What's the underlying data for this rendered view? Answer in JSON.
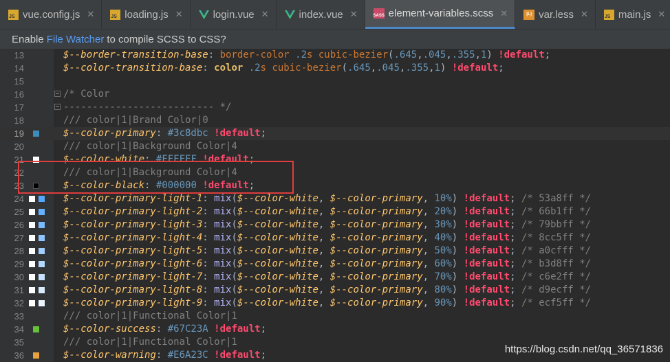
{
  "tabs": [
    {
      "label": "vue.config.js",
      "icon": "js",
      "active": false
    },
    {
      "label": "loading.js",
      "icon": "js",
      "active": false
    },
    {
      "label": "login.vue",
      "icon": "vue",
      "active": false
    },
    {
      "label": "index.vue",
      "icon": "vue",
      "active": false
    },
    {
      "label": "element-variables.scss",
      "icon": "sass",
      "active": true
    },
    {
      "label": "var.less",
      "icon": "less",
      "active": false
    },
    {
      "label": "main.js",
      "icon": "js",
      "active": false
    }
  ],
  "notice": {
    "prefix": "Enable",
    "link": "File Watcher",
    "suffix": "to compile SCSS to CSS?"
  },
  "editor": {
    "current_line": 19,
    "lines": [
      {
        "n": "13",
        "swatches": [],
        "tokens": [
          [
            "v",
            "$--border-transition-base"
          ],
          [
            "w",
            ": "
          ],
          [
            "p",
            "border-color "
          ],
          [
            "n",
            ".2"
          ],
          [
            "p",
            "s "
          ],
          [
            "p",
            "cubic-bezier"
          ],
          [
            "w",
            "("
          ],
          [
            "n",
            ".645"
          ],
          [
            "w",
            ","
          ],
          [
            "n",
            ".045"
          ],
          [
            "w",
            ","
          ],
          [
            "n",
            ".355"
          ],
          [
            "w",
            ","
          ],
          [
            "n",
            "1"
          ],
          [
            "w",
            ") "
          ],
          [
            "imp",
            "!default"
          ],
          [
            "w",
            ";"
          ]
        ]
      },
      {
        "n": "14",
        "swatches": [],
        "tokens": [
          [
            "v",
            "$--color-transition-base"
          ],
          [
            "w",
            ": "
          ],
          [
            "k",
            "color "
          ],
          [
            "n",
            ".2"
          ],
          [
            "p",
            "s "
          ],
          [
            "p",
            "cubic-bezier"
          ],
          [
            "w",
            "("
          ],
          [
            "n",
            ".645"
          ],
          [
            "w",
            ","
          ],
          [
            "n",
            ".045"
          ],
          [
            "w",
            ","
          ],
          [
            "n",
            ".355"
          ],
          [
            "w",
            ","
          ],
          [
            "n",
            "1"
          ],
          [
            "w",
            ") "
          ],
          [
            "imp",
            "!default"
          ],
          [
            "w",
            ";"
          ]
        ]
      },
      {
        "n": "15",
        "swatches": [],
        "tokens": []
      },
      {
        "n": "16",
        "swatches": [],
        "fold": true,
        "tokens": [
          [
            "c",
            "/* Color"
          ]
        ]
      },
      {
        "n": "17",
        "swatches": [],
        "fold": true,
        "tokens": [
          [
            "c",
            "-------------------------- */"
          ]
        ]
      },
      {
        "n": "18",
        "swatches": [],
        "tokens": [
          [
            "c",
            "/// color|1|Brand Color|0"
          ]
        ]
      },
      {
        "n": "19",
        "swatches": [
          "#3c8dbc"
        ],
        "tokens": [
          [
            "v",
            "$--color-primary"
          ],
          [
            "w",
            ": "
          ],
          [
            "n",
            "#3c8dbc "
          ],
          [
            "imp",
            "!default"
          ],
          [
            "w",
            ";"
          ]
        ]
      },
      {
        "n": "20",
        "swatches": [],
        "tokens": [
          [
            "c",
            "/// color|1|Background Color|4"
          ]
        ]
      },
      {
        "n": "21",
        "swatches": [
          "#FFFFFF"
        ],
        "tokens": [
          [
            "v",
            "$--color-white"
          ],
          [
            "w",
            ": "
          ],
          [
            "n",
            "#FFFFFF "
          ],
          [
            "imp",
            "!default"
          ],
          [
            "w",
            ";"
          ]
        ]
      },
      {
        "n": "22",
        "swatches": [],
        "tokens": [
          [
            "c",
            "/// color|1|Background Color|4"
          ]
        ]
      },
      {
        "n": "23",
        "swatches": [
          "#000000"
        ],
        "tokens": [
          [
            "v",
            "$--color-black"
          ],
          [
            "w",
            ": "
          ],
          [
            "n",
            "#000000 "
          ],
          [
            "imp",
            "!default"
          ],
          [
            "w",
            ";"
          ]
        ]
      },
      {
        "n": "24",
        "swatches": [
          "#FFFFFF",
          "#53a8ff"
        ],
        "tokens": [
          [
            "v",
            "$--color-primary-light-1"
          ],
          [
            "w",
            ": "
          ],
          [
            "f",
            "mix"
          ],
          [
            "w",
            "("
          ],
          [
            "v",
            "$--color-white"
          ],
          [
            "w",
            ", "
          ],
          [
            "v",
            "$--color-primary"
          ],
          [
            "w",
            ", "
          ],
          [
            "n",
            "10%"
          ],
          [
            "w",
            ") "
          ],
          [
            "imp",
            "!default"
          ],
          [
            "w",
            "; "
          ],
          [
            "c",
            "/* 53a8ff */"
          ]
        ]
      },
      {
        "n": "25",
        "swatches": [
          "#FFFFFF",
          "#66b1ff"
        ],
        "tokens": [
          [
            "v",
            "$--color-primary-light-2"
          ],
          [
            "w",
            ": "
          ],
          [
            "f",
            "mix"
          ],
          [
            "w",
            "("
          ],
          [
            "v",
            "$--color-white"
          ],
          [
            "w",
            ", "
          ],
          [
            "v",
            "$--color-primary"
          ],
          [
            "w",
            ", "
          ],
          [
            "n",
            "20%"
          ],
          [
            "w",
            ") "
          ],
          [
            "imp",
            "!default"
          ],
          [
            "w",
            "; "
          ],
          [
            "c",
            "/* 66b1ff */"
          ]
        ]
      },
      {
        "n": "26",
        "swatches": [
          "#FFFFFF",
          "#79bbff"
        ],
        "tokens": [
          [
            "v",
            "$--color-primary-light-3"
          ],
          [
            "w",
            ": "
          ],
          [
            "f",
            "mix"
          ],
          [
            "w",
            "("
          ],
          [
            "v",
            "$--color-white"
          ],
          [
            "w",
            ", "
          ],
          [
            "v",
            "$--color-primary"
          ],
          [
            "w",
            ", "
          ],
          [
            "n",
            "30%"
          ],
          [
            "w",
            ") "
          ],
          [
            "imp",
            "!default"
          ],
          [
            "w",
            "; "
          ],
          [
            "c",
            "/* 79bbff */"
          ]
        ]
      },
      {
        "n": "27",
        "swatches": [
          "#FFFFFF",
          "#8cc5ff"
        ],
        "tokens": [
          [
            "v",
            "$--color-primary-light-4"
          ],
          [
            "w",
            ": "
          ],
          [
            "f",
            "mix"
          ],
          [
            "w",
            "("
          ],
          [
            "v",
            "$--color-white"
          ],
          [
            "w",
            ", "
          ],
          [
            "v",
            "$--color-primary"
          ],
          [
            "w",
            ", "
          ],
          [
            "n",
            "40%"
          ],
          [
            "w",
            ") "
          ],
          [
            "imp",
            "!default"
          ],
          [
            "w",
            "; "
          ],
          [
            "c",
            "/* 8cc5ff */"
          ]
        ]
      },
      {
        "n": "28",
        "swatches": [
          "#FFFFFF",
          "#a0cfff"
        ],
        "tokens": [
          [
            "v",
            "$--color-primary-light-5"
          ],
          [
            "w",
            ": "
          ],
          [
            "f",
            "mix"
          ],
          [
            "w",
            "("
          ],
          [
            "v",
            "$--color-white"
          ],
          [
            "w",
            ", "
          ],
          [
            "v",
            "$--color-primary"
          ],
          [
            "w",
            ", "
          ],
          [
            "n",
            "50%"
          ],
          [
            "w",
            ") "
          ],
          [
            "imp",
            "!default"
          ],
          [
            "w",
            "; "
          ],
          [
            "c",
            "/* a0cfff */"
          ]
        ]
      },
      {
        "n": "29",
        "swatches": [
          "#FFFFFF",
          "#b3d8ff"
        ],
        "tokens": [
          [
            "v",
            "$--color-primary-light-6"
          ],
          [
            "w",
            ": "
          ],
          [
            "f",
            "mix"
          ],
          [
            "w",
            "("
          ],
          [
            "v",
            "$--color-white"
          ],
          [
            "w",
            ", "
          ],
          [
            "v",
            "$--color-primary"
          ],
          [
            "w",
            ", "
          ],
          [
            "n",
            "60%"
          ],
          [
            "w",
            ") "
          ],
          [
            "imp",
            "!default"
          ],
          [
            "w",
            "; "
          ],
          [
            "c",
            "/* b3d8ff */"
          ]
        ]
      },
      {
        "n": "30",
        "swatches": [
          "#FFFFFF",
          "#c6e2ff"
        ],
        "tokens": [
          [
            "v",
            "$--color-primary-light-7"
          ],
          [
            "w",
            ": "
          ],
          [
            "f",
            "mix"
          ],
          [
            "w",
            "("
          ],
          [
            "v",
            "$--color-white"
          ],
          [
            "w",
            ", "
          ],
          [
            "v",
            "$--color-primary"
          ],
          [
            "w",
            ", "
          ],
          [
            "n",
            "70%"
          ],
          [
            "w",
            ") "
          ],
          [
            "imp",
            "!default"
          ],
          [
            "w",
            "; "
          ],
          [
            "c",
            "/* c6e2ff */"
          ]
        ]
      },
      {
        "n": "31",
        "swatches": [
          "#FFFFFF",
          "#d9ecff"
        ],
        "tokens": [
          [
            "v",
            "$--color-primary-light-8"
          ],
          [
            "w",
            ": "
          ],
          [
            "f",
            "mix"
          ],
          [
            "w",
            "("
          ],
          [
            "v",
            "$--color-white"
          ],
          [
            "w",
            ", "
          ],
          [
            "v",
            "$--color-primary"
          ],
          [
            "w",
            ", "
          ],
          [
            "n",
            "80%"
          ],
          [
            "w",
            ") "
          ],
          [
            "imp",
            "!default"
          ],
          [
            "w",
            "; "
          ],
          [
            "c",
            "/* d9ecff */"
          ]
        ]
      },
      {
        "n": "32",
        "swatches": [
          "#FFFFFF",
          "#ecf5ff"
        ],
        "tokens": [
          [
            "v",
            "$--color-primary-light-9"
          ],
          [
            "w",
            ": "
          ],
          [
            "f",
            "mix"
          ],
          [
            "w",
            "("
          ],
          [
            "v",
            "$--color-white"
          ],
          [
            "w",
            ", "
          ],
          [
            "v",
            "$--color-primary"
          ],
          [
            "w",
            ", "
          ],
          [
            "n",
            "90%"
          ],
          [
            "w",
            ") "
          ],
          [
            "imp",
            "!default"
          ],
          [
            "w",
            "; "
          ],
          [
            "c",
            "/* ecf5ff */"
          ]
        ]
      },
      {
        "n": "33",
        "swatches": [],
        "tokens": [
          [
            "c",
            "/// color|1|Functional Color|1"
          ]
        ]
      },
      {
        "n": "34",
        "swatches": [
          "#67C23A"
        ],
        "tokens": [
          [
            "v",
            "$--color-success"
          ],
          [
            "w",
            ": "
          ],
          [
            "n",
            "#67C23A "
          ],
          [
            "imp",
            "!default"
          ],
          [
            "w",
            ";"
          ]
        ]
      },
      {
        "n": "35",
        "swatches": [],
        "tokens": [
          [
            "c",
            "/// color|1|Functional Color|1"
          ]
        ]
      },
      {
        "n": "36",
        "swatches": [
          "#E6A23C"
        ],
        "tokens": [
          [
            "v",
            "$--color-warning"
          ],
          [
            "w",
            ": "
          ],
          [
            "n",
            "#E6A23C "
          ],
          [
            "imp",
            "!default"
          ],
          [
            "w",
            ";"
          ]
        ]
      }
    ]
  },
  "watermark": "https://blog.csdn.net/qq_36571836"
}
